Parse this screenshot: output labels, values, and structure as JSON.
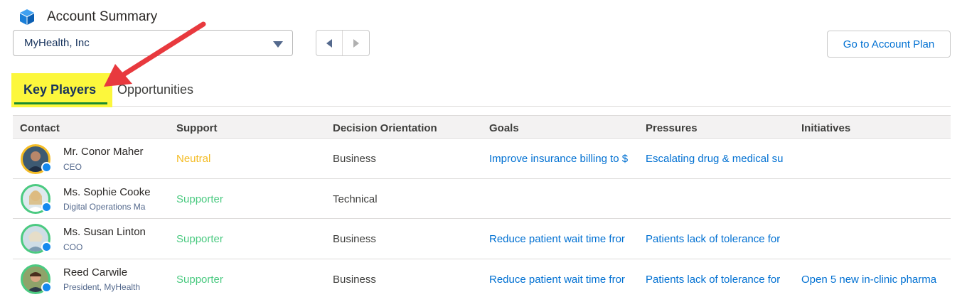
{
  "header": {
    "title": "Account Summary",
    "logo_icon": "cube-icon"
  },
  "account_select": {
    "value": "MyHealth, Inc"
  },
  "plan_button": {
    "label": "Go to Account Plan"
  },
  "tabs": [
    {
      "label": "Key Players",
      "active": true
    },
    {
      "label": "Opportunities",
      "active": false
    }
  ],
  "columns": [
    "Contact",
    "Support",
    "Decision Orientation",
    "Goals",
    "Pressures",
    "Initiatives"
  ],
  "rows": [
    {
      "name": "Mr. Conor Maher",
      "title": "CEO",
      "support": "Neutral",
      "orientation": "Business",
      "goal": "Improve insurance billing to $",
      "pressure": "Escalating drug & medical su",
      "initiative": ""
    },
    {
      "name": "Ms. Sophie Cooke",
      "title": "Digital Operations Ma",
      "support": "Supporter",
      "orientation": "Technical",
      "goal": "",
      "pressure": "",
      "initiative": ""
    },
    {
      "name": "Ms. Susan Linton",
      "title": "COO",
      "support": "Supporter",
      "orientation": "Business",
      "goal": "Reduce patient wait time fror",
      "pressure": "Patients lack of tolerance for",
      "initiative": ""
    },
    {
      "name": "Reed Carwile",
      "title": "President, MyHealth",
      "support": "Supporter",
      "orientation": "Business",
      "goal": "Reduce patient wait time fror",
      "pressure": "Patients lack of tolerance for",
      "initiative": "Open 5 new in-clinic pharma"
    }
  ],
  "colors": {
    "neutral": "#f4bc25",
    "supporter": "#4bca81",
    "link": "#0070d2",
    "highlight": "#fcf73c",
    "arrow": "#e8393e"
  }
}
